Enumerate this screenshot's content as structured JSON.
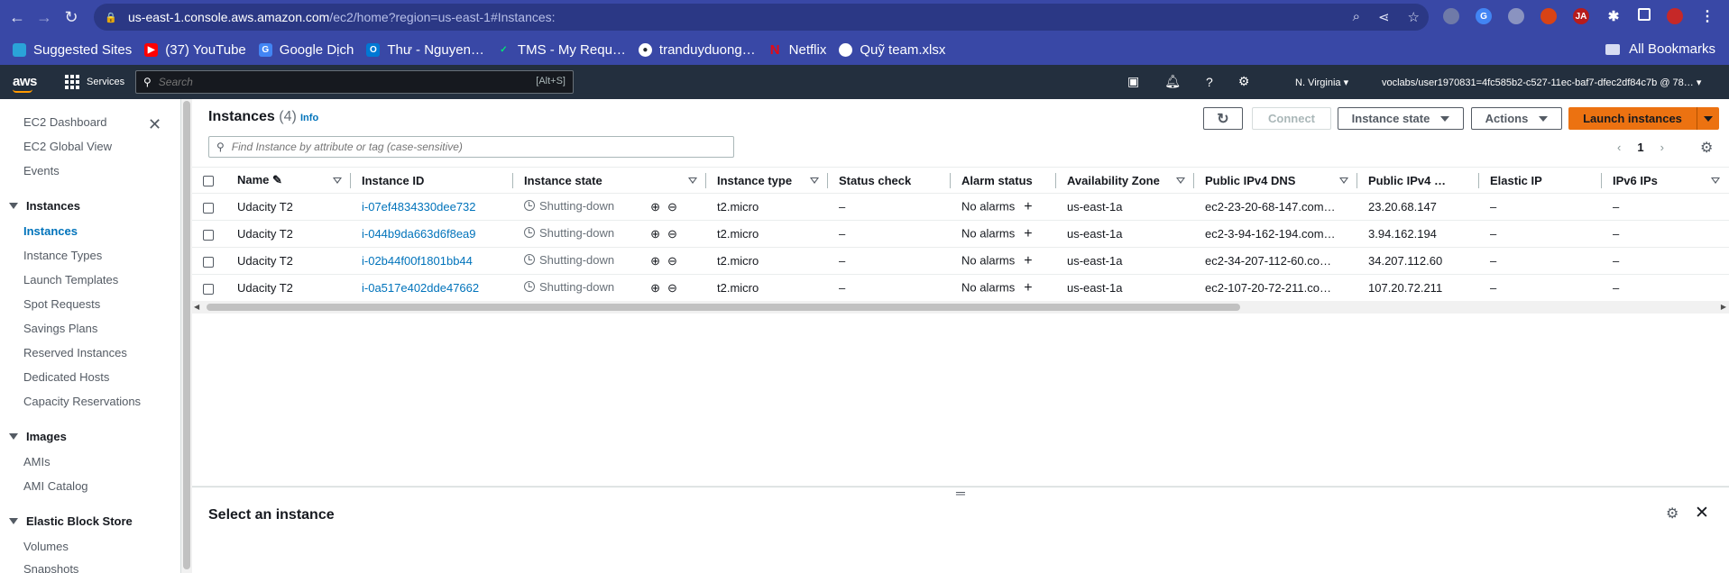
{
  "browser": {
    "url_host": "us-east-1.console.aws.amazon.com",
    "url_path": "/ec2/home?region=us-east-1#Instances:",
    "bookmarks": [
      {
        "label": "Suggested Sites",
        "color": "#2aa3d8"
      },
      {
        "label": "(37) YouTube",
        "color": "#ff0000"
      },
      {
        "label": "Google Dịch",
        "color": "#4285f4"
      },
      {
        "label": "Thư - Nguyen…",
        "color": "#0078d4"
      },
      {
        "label": "TMS - My Requ…",
        "color": "#00a651"
      },
      {
        "label": "tranduyduong…",
        "color": "#24292e"
      },
      {
        "label": "Netflix",
        "color": "#e50914"
      },
      {
        "label": "Quỹ team.xlsx",
        "color": "#ffffff"
      }
    ],
    "all_bookmarks": "All Bookmarks"
  },
  "awsnav": {
    "logo": "aws",
    "services": "Services",
    "search_placeholder": "Search",
    "search_shortcut": "[Alt+S]",
    "region": "N. Virginia ▾",
    "account": "voclabs/user1970831=4fc585b2-c527-11ec-baf7-dfec2df84c7b @ 78… ▾"
  },
  "sidebar": {
    "top_items": [
      "EC2 Dashboard",
      "EC2 Global View",
      "Events"
    ],
    "sections": [
      {
        "title": "Instances",
        "items": [
          "Instances",
          "Instance Types",
          "Launch Templates",
          "Spot Requests",
          "Savings Plans",
          "Reserved Instances",
          "Dedicated Hosts",
          "Capacity Reservations"
        ]
      },
      {
        "title": "Images",
        "items": [
          "AMIs",
          "AMI Catalog"
        ]
      },
      {
        "title": "Elastic Block Store",
        "items": [
          "Volumes",
          "Snapshots"
        ]
      }
    ],
    "active_item": "Instances"
  },
  "main": {
    "title": "Instances",
    "count": "(4)",
    "info": "Info",
    "connect": "Connect",
    "instance_state": "Instance state",
    "actions": "Actions",
    "launch": "Launch instances",
    "filter_placeholder": "Find Instance by attribute or tag (case-sensitive)",
    "page": "1",
    "columns": [
      "Name",
      "Instance ID",
      "Instance state",
      "Instance type",
      "Status check",
      "Alarm status",
      "Availability Zone",
      "Public IPv4 DNS",
      "Public IPv4 …",
      "Elastic IP",
      "IPv6 IPs"
    ],
    "rows": [
      {
        "name": "Udacity T2",
        "id": "i-07ef4834330dee732",
        "state": "Shutting-down",
        "type": "t2.micro",
        "status": "–",
        "alarm": "No alarms",
        "az": "us-east-1a",
        "dns": "ec2-23-20-68-147.com…",
        "ipv4": "23.20.68.147",
        "eip": "–",
        "ipv6": "–"
      },
      {
        "name": "Udacity T2",
        "id": "i-044b9da663d6f8ea9",
        "state": "Shutting-down",
        "type": "t2.micro",
        "status": "–",
        "alarm": "No alarms",
        "az": "us-east-1a",
        "dns": "ec2-3-94-162-194.com…",
        "ipv4": "3.94.162.194",
        "eip": "–",
        "ipv6": "–"
      },
      {
        "name": "Udacity T2",
        "id": "i-02b44f00f1801bb44",
        "state": "Shutting-down",
        "type": "t2.micro",
        "status": "–",
        "alarm": "No alarms",
        "az": "us-east-1a",
        "dns": "ec2-34-207-112-60.co…",
        "ipv4": "34.207.112.60",
        "eip": "–",
        "ipv6": "–"
      },
      {
        "name": "Udacity T2",
        "id": "i-0a517e402dde47662",
        "state": "Shutting-down",
        "type": "t2.micro",
        "status": "–",
        "alarm": "No alarms",
        "az": "us-east-1a",
        "dns": "ec2-107-20-72-211.co…",
        "ipv4": "107.20.72.211",
        "eip": "–",
        "ipv6": "–"
      }
    ]
  },
  "split": {
    "title": "Select an instance"
  },
  "colors": {
    "chrome": "#3948a6",
    "aws_nav": "#232f3e",
    "primary": "#ec7211",
    "link": "#0073bb"
  }
}
